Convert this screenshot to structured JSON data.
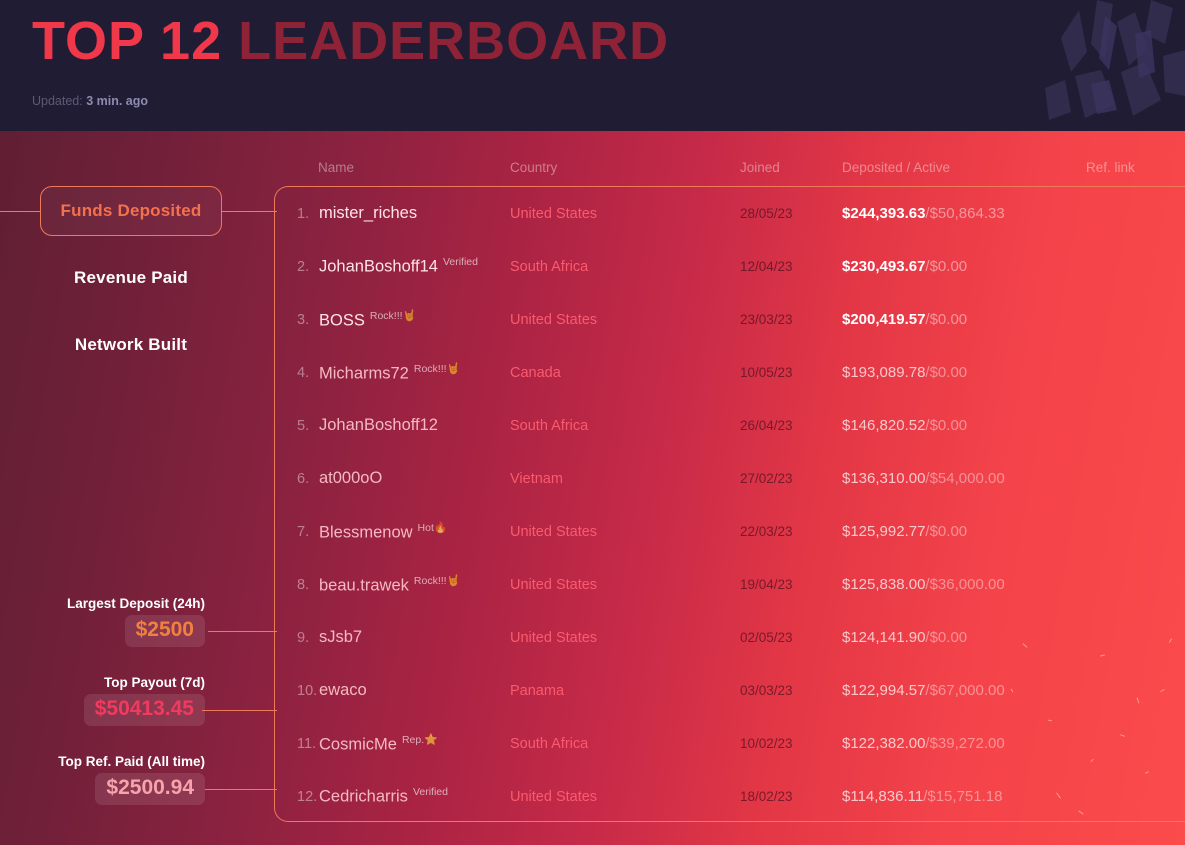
{
  "header": {
    "title_primary": "TOP 12",
    "title_secondary": "LEADERBOARD",
    "updated_label": "Updated:",
    "updated_value": "3 min. ago"
  },
  "colors": {
    "accent_border": "#ef7a59",
    "title_primary": "#f0384a",
    "title_secondary": "#8e2236",
    "header_bg": "#201c33",
    "country": "#fb5a6e",
    "stat_orange": "#f2803f",
    "stat_pink": "#f23a5e",
    "stat_light": "#f7a3ad"
  },
  "tabs": [
    {
      "label": "Funds Deposited",
      "active": true
    },
    {
      "label": "Revenue Paid",
      "active": false
    },
    {
      "label": "Network Built",
      "active": false
    }
  ],
  "stats": [
    {
      "title": "Largest Deposit (24h)",
      "value": "$2500",
      "color": "#f2803f"
    },
    {
      "title": "Top Payout (7d)",
      "value": "$50413.45",
      "color": "#f23a5e"
    },
    {
      "title": "Top Ref. Paid (All time)",
      "value": "$2500.94",
      "color": "#f7a3ad"
    }
  ],
  "table": {
    "columns": [
      "Name",
      "Country",
      "Joined",
      "Deposited / Active",
      "Ref. link"
    ],
    "rows": [
      {
        "rank": "1.",
        "name": "mister_riches",
        "badge": "",
        "badge_emoji": "",
        "country": "United States",
        "joined": "28/05/23",
        "deposited": "$244,393.63",
        "active": "$50,864.33"
      },
      {
        "rank": "2.",
        "name": "JohanBoshoff14",
        "badge": "Verified",
        "badge_emoji": "",
        "country": "South Africa",
        "joined": "12/04/23",
        "deposited": "$230,493.67",
        "active": "$0.00"
      },
      {
        "rank": "3.",
        "name": "BOSS",
        "badge": "Rock!!!",
        "badge_emoji": "🤘",
        "country": "United States",
        "joined": "23/03/23",
        "deposited": "$200,419.57",
        "active": "$0.00"
      },
      {
        "rank": "4.",
        "name": "Micharms72",
        "badge": "Rock!!!",
        "badge_emoji": "🤘",
        "country": "Canada",
        "joined": "10/05/23",
        "deposited": "$193,089.78",
        "active": "$0.00"
      },
      {
        "rank": "5.",
        "name": "JohanBoshoff12",
        "badge": "",
        "badge_emoji": "",
        "country": "South Africa",
        "joined": "26/04/23",
        "deposited": "$146,820.52",
        "active": "$0.00"
      },
      {
        "rank": "6.",
        "name": "at000oO",
        "badge": "",
        "badge_emoji": "",
        "country": "Vietnam",
        "joined": "27/02/23",
        "deposited": "$136,310.00",
        "active": "$54,000.00"
      },
      {
        "rank": "7.",
        "name": "Blessmenow",
        "badge": "Hot",
        "badge_emoji": "🔥",
        "country": "United States",
        "joined": "22/03/23",
        "deposited": "$125,992.77",
        "active": "$0.00"
      },
      {
        "rank": "8.",
        "name": "beau.trawek",
        "badge": "Rock!!!",
        "badge_emoji": "🤘",
        "country": "United States",
        "joined": "19/04/23",
        "deposited": "$125,838.00",
        "active": "$36,000.00"
      },
      {
        "rank": "9.",
        "name": "sJsb7",
        "badge": "",
        "badge_emoji": "",
        "country": "United States",
        "joined": "02/05/23",
        "deposited": "$124,141.90",
        "active": "$0.00"
      },
      {
        "rank": "10.",
        "name": "ewaco",
        "badge": "",
        "badge_emoji": "",
        "country": "Panama",
        "joined": "03/03/23",
        "deposited": "$122,994.57",
        "active": "$67,000.00"
      },
      {
        "rank": "11.",
        "name": "CosmicMe",
        "badge": "Rep.",
        "badge_emoji": "⭐",
        "country": "South Africa",
        "joined": "10/02/23",
        "deposited": "$122,382.00",
        "active": "$39,272.00"
      },
      {
        "rank": "12.",
        "name": "Cedricharris",
        "badge": "Verified",
        "badge_emoji": "",
        "country": "United States",
        "joined": "18/02/23",
        "deposited": "$114,836.11",
        "active": "$15,751.18"
      }
    ]
  }
}
